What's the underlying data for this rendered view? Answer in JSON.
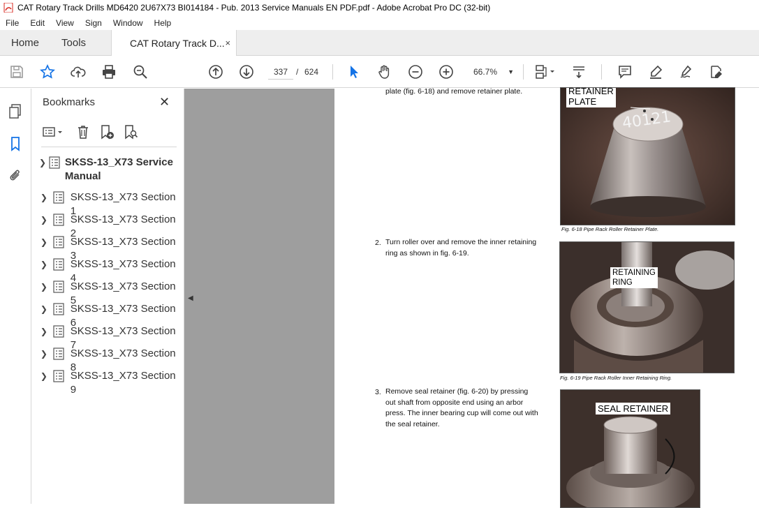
{
  "window": {
    "title": "CAT Rotary Track Drills MD6420 2U67X73 BI014184 - Pub. 2013 Service Manuals EN PDF.pdf - Adobe Acrobat Pro DC (32-bit)"
  },
  "menu": [
    "File",
    "Edit",
    "View",
    "Sign",
    "Window",
    "Help"
  ],
  "tabs": {
    "home": "Home",
    "tools": "Tools",
    "document": "CAT Rotary Track D...",
    "close": "×"
  },
  "toolbar": {
    "page_current": "337",
    "page_sep": "/",
    "page_total": "624",
    "zoom": "66.7%",
    "zoom_caret": "▼"
  },
  "bookmarks": {
    "title": "Bookmarks",
    "close": "✕",
    "items": [
      {
        "label": "SKSS-13_X73 Service Manual"
      },
      {
        "label": "SKSS-13_X73 Section 1"
      },
      {
        "label": "SKSS-13_X73 Section 2"
      },
      {
        "label": "SKSS-13_X73 Section 3"
      },
      {
        "label": "SKSS-13_X73 Section 4"
      },
      {
        "label": "SKSS-13_X73 Section 5"
      },
      {
        "label": "SKSS-13_X73 Section 6"
      },
      {
        "label": "SKSS-13_X73 Section 7"
      },
      {
        "label": "SKSS-13_X73 Section 8"
      },
      {
        "label": "SKSS-13_X73 Section 9"
      }
    ]
  },
  "document": {
    "step1_tail": "plate (fig. 6-18) and remove retainer plate.",
    "fig18": {
      "label_line1": "RETAINER",
      "label_line2": "PLATE",
      "marking": "40121",
      "caption": "Fig. 6-18 Pipe Rack Roller Retainer Plate."
    },
    "step2": {
      "num": "2.",
      "line1": "Turn roller over and remove the inner retaining",
      "line2": "ring as shown in fig. 6-19."
    },
    "fig19": {
      "label_line1": "RETAINING",
      "label_line2": "RING",
      "caption": "Fig. 6-19 Pipe Rack Roller Inner Retaining Ring."
    },
    "step3": {
      "num": "3.",
      "line1": "Remove seal retainer (fig. 6-20) by pressing",
      "line2": "out shaft from opposite end using an arbor",
      "line3": "press. The inner bearing cup will come out with",
      "line4": "the seal retainer."
    },
    "fig20": {
      "label": "SEAL RETAINER"
    }
  },
  "colors": {
    "accent": "#1473e6",
    "pdf_red": "#d7261e",
    "doc_bg": "#9e9e9e"
  }
}
